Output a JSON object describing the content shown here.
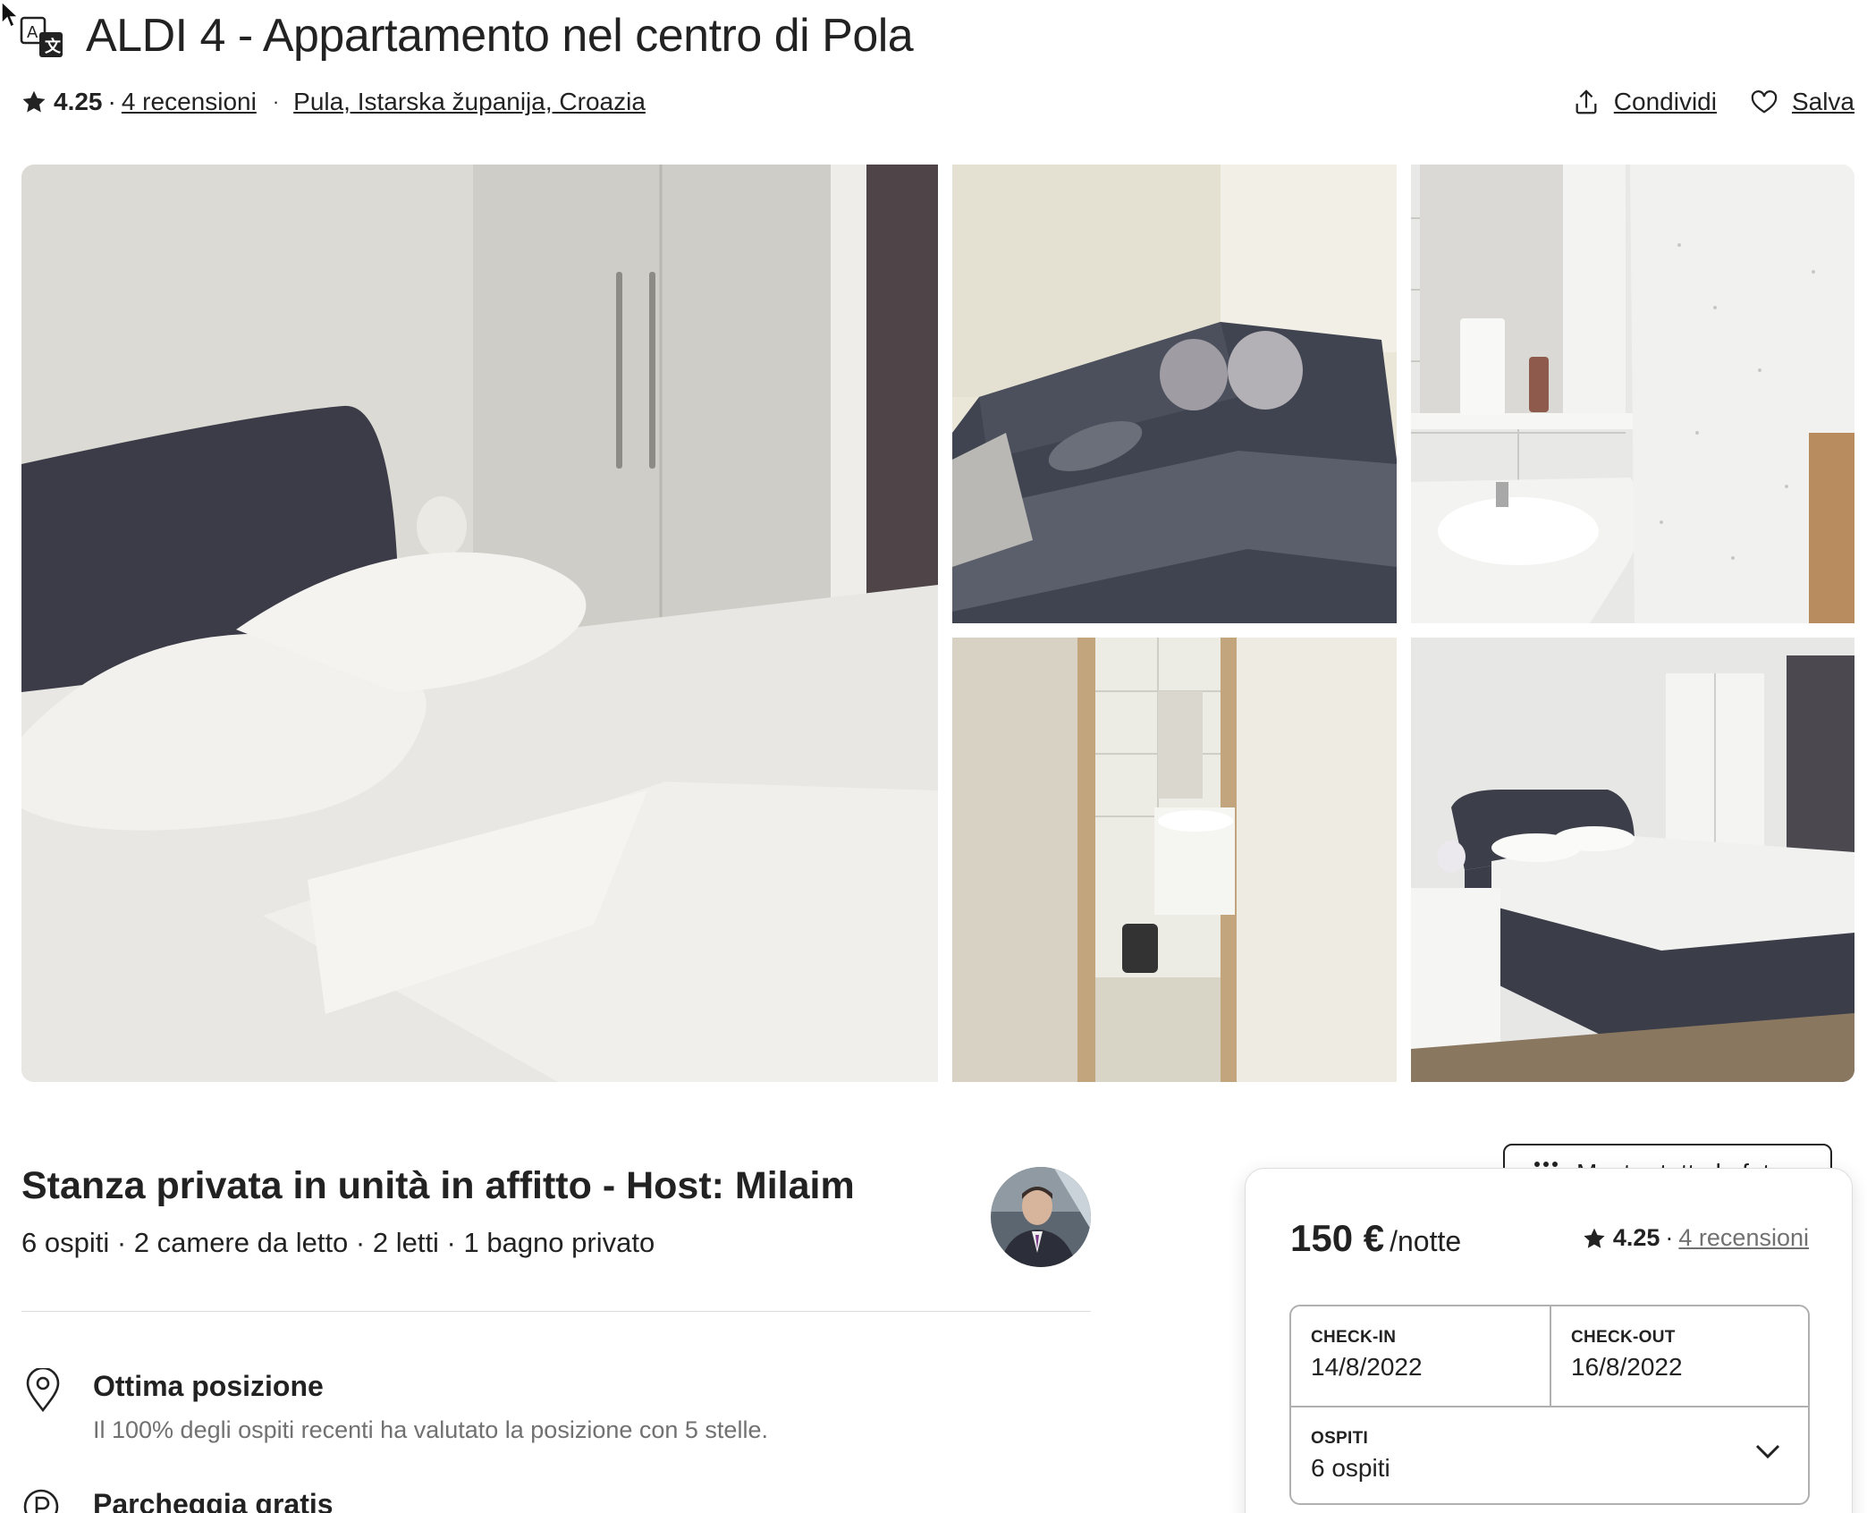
{
  "header": {
    "title": "ALDI 4 - Appartamento nel centro di Pola",
    "rating": "4.25",
    "rating_sep": "·",
    "reviews": "4 recensioni",
    "dot": "·",
    "location": "Pula, Istarska županija, Croazia",
    "share_label": "Condividi",
    "save_label": "Salva"
  },
  "gallery": {
    "show_all_label": "Mostra tutte le foto"
  },
  "listing": {
    "subtitle": "Stanza privata in unità in affitto - Host: Milaim",
    "facts": "6 ospiti · 2 camere da letto · 2 letti · 1 bagno privato",
    "features": [
      {
        "icon": "location-pin-icon",
        "title": "Ottima posizione",
        "desc": "Il 100% degli ospiti recenti ha valutato la posizione con 5 stelle."
      },
      {
        "icon": "parking-icon",
        "title": "Parcheggia gratis",
        "desc": ""
      }
    ]
  },
  "booking": {
    "price": "150 €",
    "per_night": "/notte",
    "rating": "4.25",
    "rating_sep": "·",
    "reviews": "4 recensioni",
    "checkin_label": "CHECK-IN",
    "checkin_value": "14/8/2022",
    "checkout_label": "CHECK-OUT",
    "checkout_value": "16/8/2022",
    "guests_label": "OSPITI",
    "guests_value": "6 ospiti"
  },
  "colors": {
    "text": "#222222",
    "muted": "#717171",
    "border": "#b0b0b0",
    "divider": "#dddddd"
  }
}
